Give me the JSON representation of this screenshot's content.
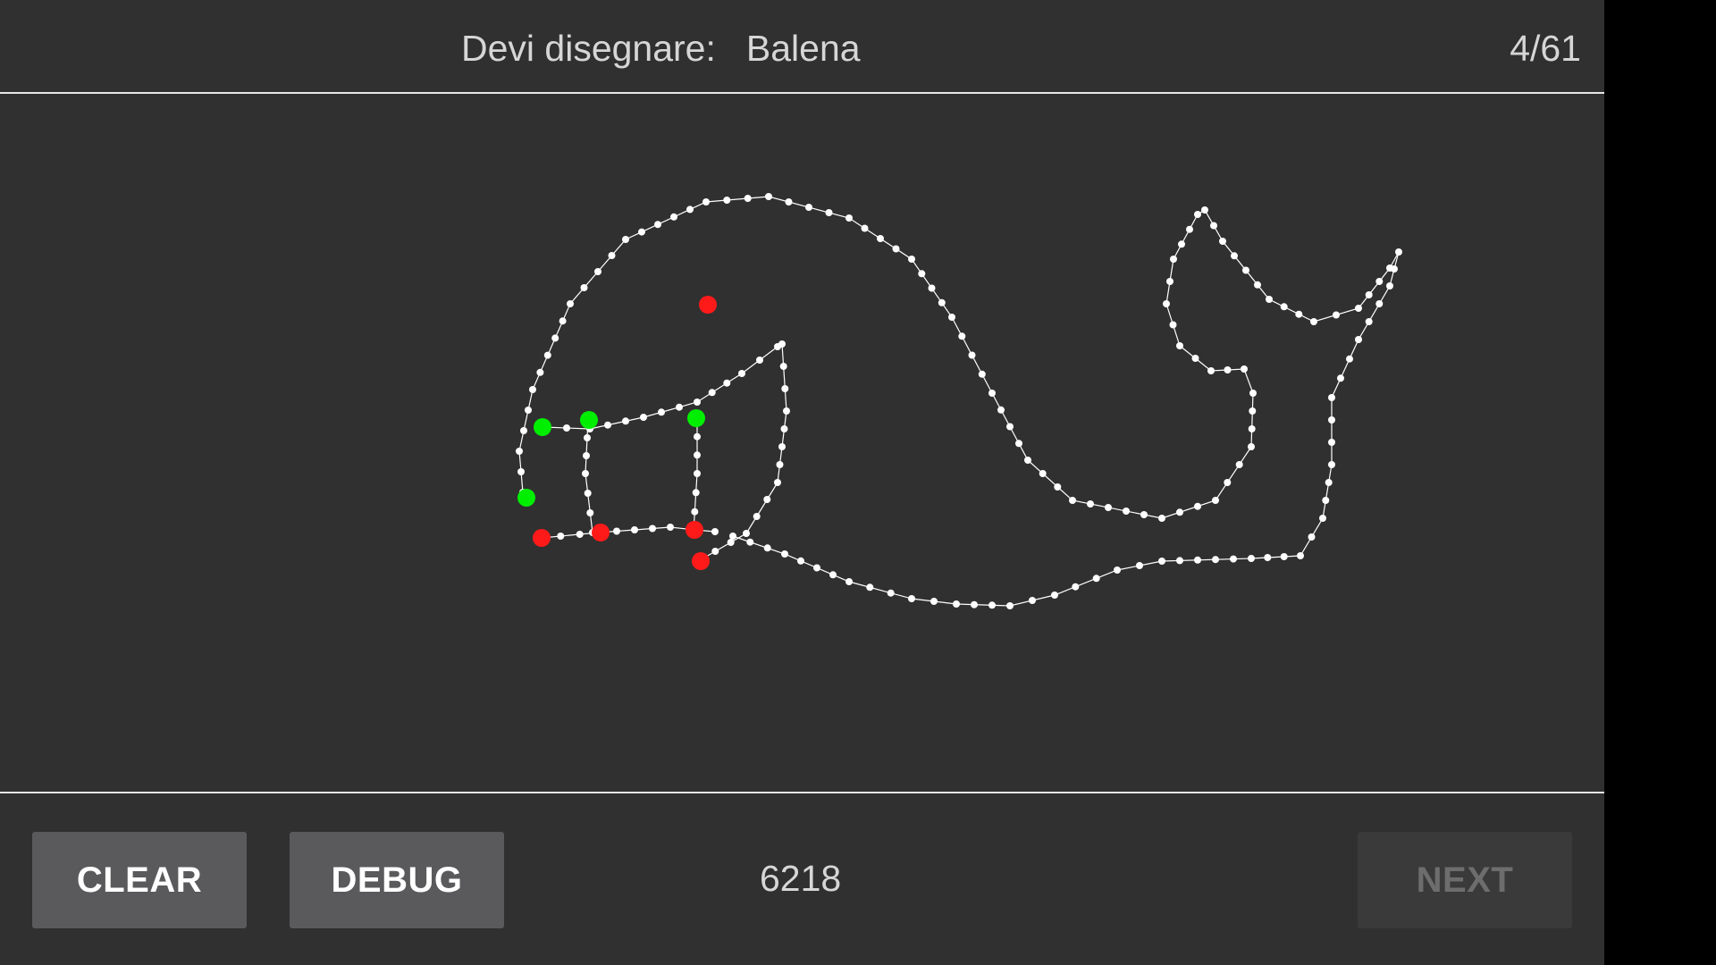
{
  "header": {
    "prompt_label": "Devi disegnare:",
    "prompt_word": "Balena",
    "counter": "4/61"
  },
  "drawing": {
    "subject": "whale",
    "stroke_color": "#ffffff",
    "green_marker_color": "#00ee00",
    "red_marker_color": "#ff1a1a"
  },
  "footer": {
    "clear_label": "CLEAR",
    "debug_label": "DEBUG",
    "score": "6218",
    "next_label": "NEXT",
    "next_enabled": false
  },
  "colors": {
    "background": "#303030",
    "button": "#5a5a5c",
    "button_disabled": "#3a3a3a",
    "divider": "#e6e6e6"
  }
}
